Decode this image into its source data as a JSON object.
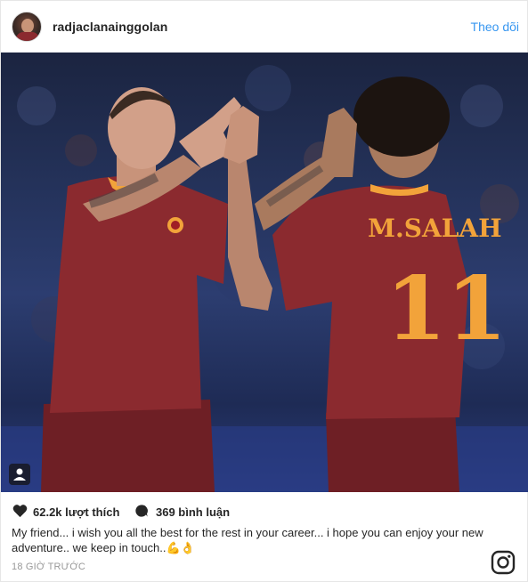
{
  "header": {
    "username": "radjaclanainggolan",
    "follow_label": "Theo dõi"
  },
  "photo": {
    "jersey_name": "M.SALAH",
    "jersey_number": "11"
  },
  "stats": {
    "likes": "62.2k lượt thích",
    "comments": "369 bình luận"
  },
  "caption": {
    "text": "My friend... i wish you all the best for the rest in your career... i hope you can enjoy your new adventure.. we keep in touch..💪👌"
  },
  "timestamp": "18 GIỜ TRƯỚC",
  "icons": {
    "like": "heart-icon",
    "comment": "comment-bubble-icon",
    "tag": "user-tag-icon",
    "brand": "instagram-icon"
  },
  "colors": {
    "follow": "#3897f0",
    "text": "#262626",
    "muted": "#999999",
    "jersey": "#8b2a2f",
    "jersey_trim": "#f2a33a"
  }
}
